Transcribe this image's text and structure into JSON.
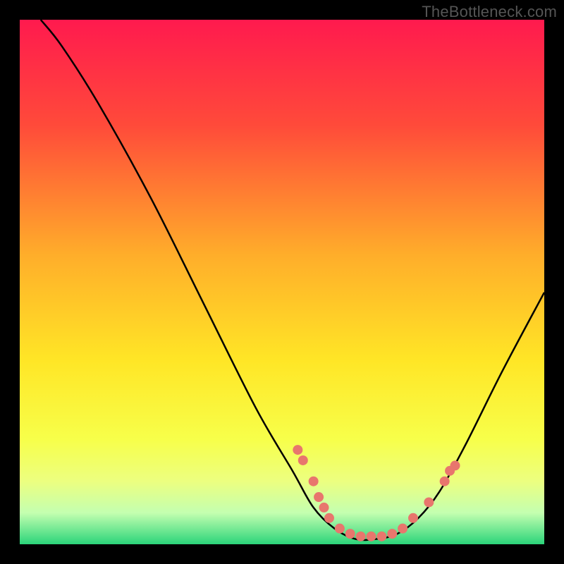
{
  "watermark": "TheBottleneck.com",
  "chart_data": {
    "type": "line",
    "title": "",
    "xlabel": "",
    "ylabel": "",
    "xlim": [
      0,
      100
    ],
    "ylim": [
      0,
      100
    ],
    "grid": false,
    "legend": false,
    "gradient_stops": [
      {
        "offset": 0,
        "color": "#ff1a4e"
      },
      {
        "offset": 20,
        "color": "#ff4a3a"
      },
      {
        "offset": 45,
        "color": "#ffae2a"
      },
      {
        "offset": 65,
        "color": "#ffe626"
      },
      {
        "offset": 80,
        "color": "#f7ff4a"
      },
      {
        "offset": 88,
        "color": "#ecff80"
      },
      {
        "offset": 94,
        "color": "#c4ffb0"
      },
      {
        "offset": 100,
        "color": "#2bd47a"
      }
    ],
    "curve": [
      {
        "x": 4,
        "y": 100
      },
      {
        "x": 8,
        "y": 95
      },
      {
        "x": 15,
        "y": 84
      },
      {
        "x": 25,
        "y": 66
      },
      {
        "x": 35,
        "y": 46
      },
      {
        "x": 45,
        "y": 26
      },
      {
        "x": 52,
        "y": 14
      },
      {
        "x": 56,
        "y": 7
      },
      {
        "x": 60,
        "y": 3
      },
      {
        "x": 64,
        "y": 1
      },
      {
        "x": 68,
        "y": 1
      },
      {
        "x": 72,
        "y": 2
      },
      {
        "x": 76,
        "y": 5
      },
      {
        "x": 80,
        "y": 10
      },
      {
        "x": 85,
        "y": 19
      },
      {
        "x": 92,
        "y": 33
      },
      {
        "x": 100,
        "y": 48
      }
    ],
    "markers": [
      {
        "x": 53,
        "y": 18
      },
      {
        "x": 54,
        "y": 16
      },
      {
        "x": 56,
        "y": 12
      },
      {
        "x": 57,
        "y": 9
      },
      {
        "x": 58,
        "y": 7
      },
      {
        "x": 59,
        "y": 5
      },
      {
        "x": 61,
        "y": 3
      },
      {
        "x": 63,
        "y": 2
      },
      {
        "x": 65,
        "y": 1.5
      },
      {
        "x": 67,
        "y": 1.5
      },
      {
        "x": 69,
        "y": 1.5
      },
      {
        "x": 71,
        "y": 2
      },
      {
        "x": 73,
        "y": 3
      },
      {
        "x": 75,
        "y": 5
      },
      {
        "x": 78,
        "y": 8
      },
      {
        "x": 81,
        "y": 12
      },
      {
        "x": 82,
        "y": 14
      },
      {
        "x": 83,
        "y": 15
      }
    ],
    "marker_color": "#e8766d",
    "curve_color": "#000000"
  }
}
